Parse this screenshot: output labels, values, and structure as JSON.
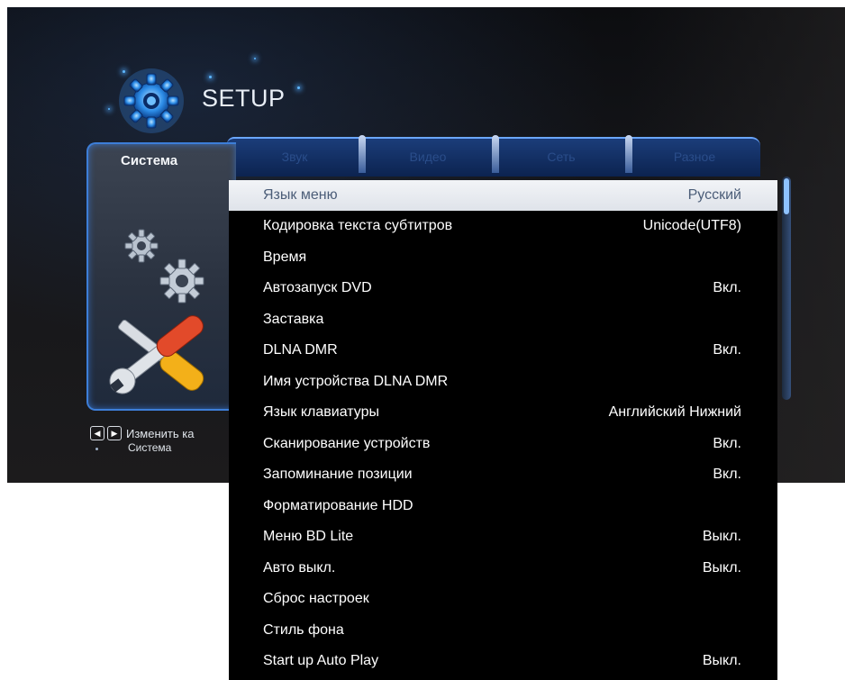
{
  "header": {
    "title": "SETUP"
  },
  "tabs": [
    {
      "label": "Система",
      "active": true
    },
    {
      "label": "Звук",
      "active": false
    },
    {
      "label": "Видео",
      "active": false
    },
    {
      "label": "Сеть",
      "active": false
    },
    {
      "label": "Разное",
      "active": false
    }
  ],
  "footer": {
    "hint": "Изменить ка",
    "breadcrumb": "Система"
  },
  "menu": {
    "selected_index": 0,
    "items": [
      {
        "label": "Язык меню",
        "value": "Русский"
      },
      {
        "label": "Кодировка текста субтитров",
        "value": "Unicode(UTF8)"
      },
      {
        "label": "Время",
        "value": ""
      },
      {
        "label": "Автозапуск DVD",
        "value": "Вкл."
      },
      {
        "label": "Заставка",
        "value": ""
      },
      {
        "label": "DLNA DMR",
        "value": "Вкл."
      },
      {
        "label": "Имя устройства DLNA DMR",
        "value": ""
      },
      {
        "label": "Язык клавиатуры",
        "value": "Английский Нижний"
      },
      {
        "label": "Сканирование устройств",
        "value": "Вкл."
      },
      {
        "label": "Запоминание позиции",
        "value": "Вкл."
      },
      {
        "label": "Форматирование HDD",
        "value": ""
      },
      {
        "label": "Меню BD Lite",
        "value": "Выкл."
      },
      {
        "label": "Авто выкл.",
        "value": "Выкл."
      },
      {
        "label": "Сброс настроек",
        "value": ""
      },
      {
        "label": "Стиль фона",
        "value": ""
      },
      {
        "label": "Start up Auto Play",
        "value": "Выкл."
      }
    ]
  },
  "colors": {
    "accent": "#3d7ed8",
    "selected_row": "#e9ecf1",
    "selected_text": "#4b5d78",
    "list_bg": "#000000"
  },
  "icons": [
    "setup-gear-icon",
    "gear-icon",
    "tools-icon",
    "arrow-left-icon",
    "arrow-right-icon"
  ]
}
